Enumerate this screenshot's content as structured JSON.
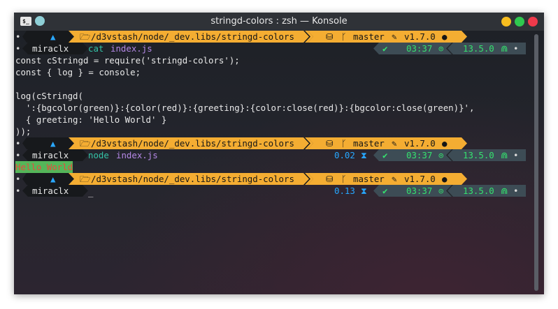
{
  "window": {
    "title": "stringd-colors : zsh — Konsole",
    "app_icon_text": "$_"
  },
  "colors": {
    "prompt_dark": "#17191c",
    "prompt_gold": "#f4ad32",
    "prompt_gray": "#3d4c55",
    "status_green": "#35e26f",
    "path_arrow_blue": "#2aa8ff",
    "cmd_teal": "#33c3a7",
    "arg_purple": "#b488e6",
    "bg_green": "#54b659",
    "fg_red": "#e84a3d"
  },
  "prompt": {
    "bullet": "•",
    "os_icon": "▲",
    "folder_icon": "🗁",
    "path": "/d3vstash/node/_dev.libs/stringd-colors",
    "git_icon": "⛁",
    "branch_icon": "ᚴ",
    "branch": "master",
    "tag_icon": "✎",
    "version": "v1.7.0",
    "dot": "●",
    "user": "miraclx",
    "check_icon": "✔",
    "clock_icon": "⊙",
    "node_icon": "⋒",
    "node_version": "13.5.0",
    "hourglass_icon": "⧗"
  },
  "session": {
    "cmd1": {
      "command": "cat",
      "arg": "index.js",
      "time": "03:37"
    },
    "code": [
      "const cStringd = require('stringd-colors');",
      "const { log } = console;",
      "",
      "log(cStringd(",
      "  ':{bgcolor(green)}:{color(red)}:{greeting}:{color:close(red)}:{bgcolor:close(green)}',",
      "  { greeting: 'Hello World' }",
      "));"
    ],
    "cmd2": {
      "command": "node",
      "arg": "index.js",
      "duration": "0.02",
      "time": "03:37",
      "output": "Hello World"
    },
    "cmd3": {
      "duration": "0.13",
      "time": "03:37",
      "cursor": "_"
    }
  }
}
